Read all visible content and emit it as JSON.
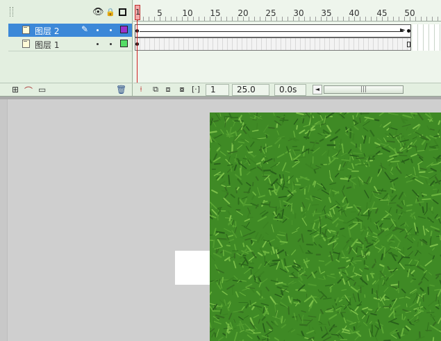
{
  "timeline": {
    "layers": [
      {
        "name": "图层 2",
        "selected": true,
        "color": "#9933cc"
      },
      {
        "name": "图层 1",
        "selected": false,
        "color": "#55dd66"
      }
    ],
    "ruler_labels": [
      "1",
      "5",
      "10",
      "15",
      "20",
      "25",
      "30",
      "35",
      "40",
      "45",
      "50"
    ],
    "playhead_frame": "1",
    "current_frame": "1",
    "frame_rate": "25.0 fps",
    "elapsed_time": "0.0s"
  },
  "icons": {
    "eye": "eye-icon",
    "lock": "lock-icon",
    "outline": "outline-icon",
    "add_layer": "add-layer-icon",
    "add_guide": "add-motion-guide-icon",
    "add_folder": "add-folder-icon",
    "delete": "trash-icon"
  },
  "stage": {
    "image_texture": "green grass"
  }
}
